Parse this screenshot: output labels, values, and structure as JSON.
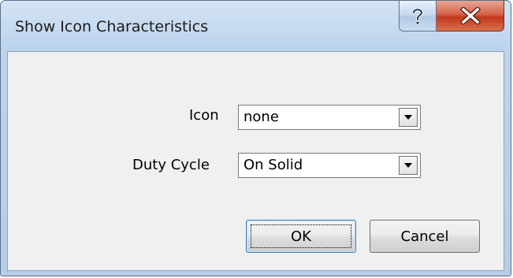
{
  "window": {
    "title": "Show Icon Characteristics",
    "help_icon": "question-mark-icon",
    "close_icon": "close-x-icon"
  },
  "form": {
    "icon": {
      "label": "Icon",
      "value": "none"
    },
    "duty_cycle": {
      "label": "Duty Cycle",
      "value": "On Solid"
    }
  },
  "buttons": {
    "ok": "OK",
    "cancel": "Cancel"
  },
  "colors": {
    "close_button": "#c7432a",
    "frame": "#bcd3ec",
    "client": "#f0f0f0"
  }
}
